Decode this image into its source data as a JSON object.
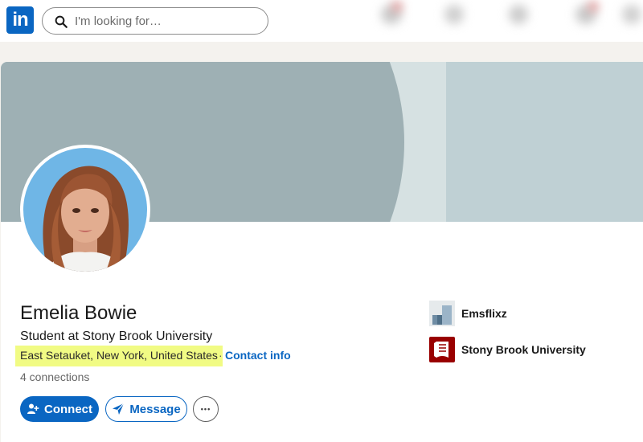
{
  "nav": {
    "logo_text": "in",
    "search_placeholder": "I'm looking for…"
  },
  "profile": {
    "name": "Emelia Bowie",
    "headline": "Student at Stony Brook University",
    "location": "East Setauket, New York, United States",
    "separator": "·",
    "contact_link": "Contact info",
    "connections": "4 connections"
  },
  "actions": {
    "connect_label": "Connect",
    "message_label": "Message",
    "more_label": "•••"
  },
  "organizations": [
    {
      "name": "Emsflixz",
      "icon": "company-logo-icon"
    },
    {
      "name": "Stony Brook University",
      "icon": "university-logo-icon"
    }
  ],
  "colors": {
    "brand": "#0a66c2",
    "highlight": "#f1fb84",
    "university": "#990000"
  }
}
